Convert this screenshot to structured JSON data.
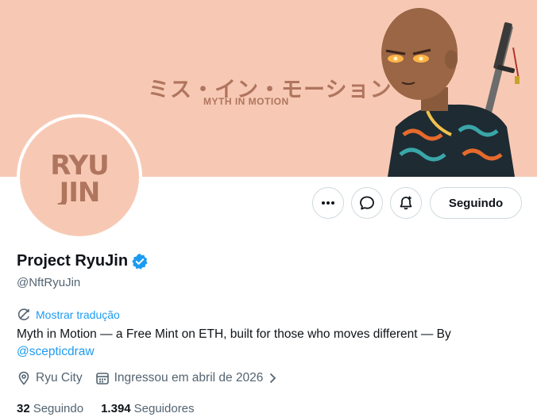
{
  "banner": {
    "jp_text": "ミス・イン・モーション",
    "en_text": "MYTH IN MOTION"
  },
  "avatar": {
    "logo_line1": "RYU",
    "logo_line2": "JIN",
    "color": "#b0755e"
  },
  "actions": {
    "more_icon": "more-dots-icon",
    "message_icon": "message-icon",
    "notify_icon": "bell-plus-icon",
    "follow_label": "Seguindo"
  },
  "profile": {
    "display_name": "Project RyuJin",
    "handle": "@NftRyuJin",
    "verified": true,
    "translate_label": "Mostrar tradução",
    "bio_text": "Myth in Motion — a Free Mint on ETH, built for those who moves different — By ",
    "bio_mention": "@scepticdraw",
    "location": "Ryu City",
    "joined": "Ingressou em abril de 2026"
  },
  "stats": {
    "following_count": "32",
    "following_label": "Seguindo",
    "followers_count": "1.394",
    "followers_label": "Seguidores"
  },
  "colors": {
    "accent": "#1d9bf0",
    "banner_bg": "#f7c9b4",
    "muted": "#536471"
  }
}
